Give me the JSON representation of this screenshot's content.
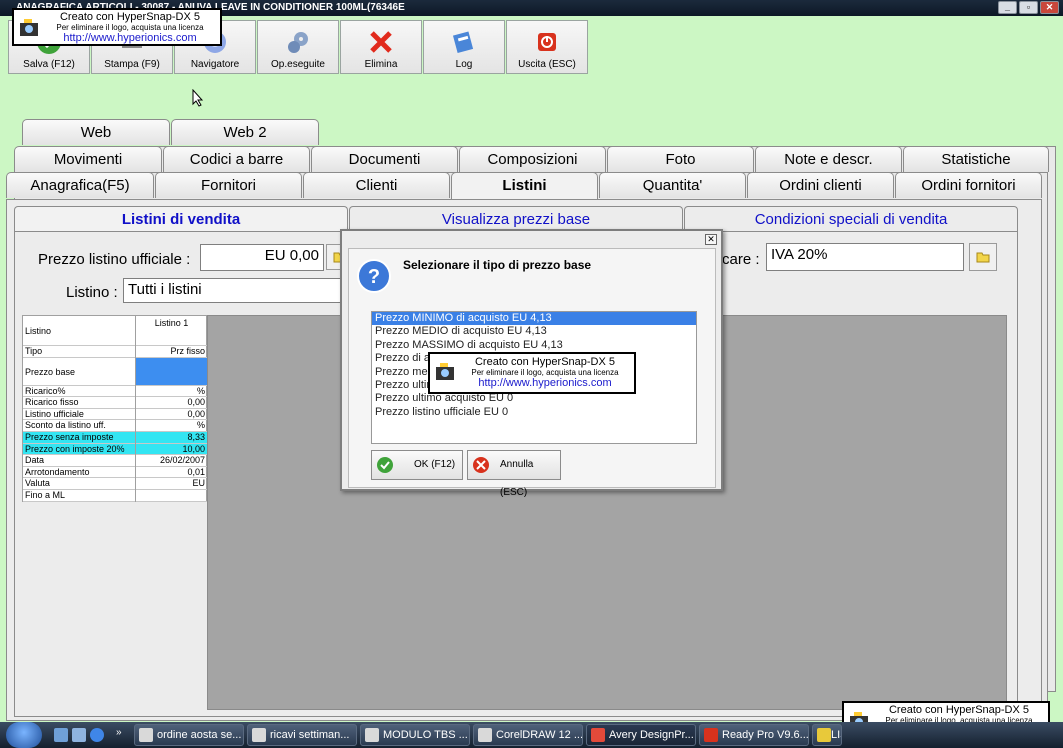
{
  "window": {
    "title": "ANAGRAFICA ARTICOLI - 30087 - ANUVA LEAVE IN CONDITIONER 100ML(76346E"
  },
  "watermark": {
    "line1": "Creato con HyperSnap-DX 5",
    "line2": "Per eliminare il logo, acquista una licenza",
    "line3": "http://www.hyperionics.com"
  },
  "toolbar": [
    {
      "label": "Salva (F12)",
      "icon": "save-icon"
    },
    {
      "label": "Stampa (F9)",
      "icon": "print-icon"
    },
    {
      "label": "Navigatore",
      "icon": "navigator-icon"
    },
    {
      "label": "Op.eseguite",
      "icon": "gears-icon"
    },
    {
      "label": "Elimina",
      "icon": "delete-icon"
    },
    {
      "label": "Log",
      "icon": "log-icon"
    },
    {
      "label": "Uscita (ESC)",
      "icon": "exit-icon"
    }
  ],
  "tabs": {
    "row1": [
      "Web",
      "Web 2"
    ],
    "row2": [
      "Movimenti",
      "Codici a barre",
      "Documenti",
      "Composizioni",
      "Foto",
      "Note e descr.",
      "Statistiche"
    ],
    "row3": [
      "Anagrafica(F5)",
      "Fornitori",
      "Clienti",
      "Listini",
      "Quantita'",
      "Ordini clienti",
      "Ordini fornitori"
    ],
    "active": "Listini"
  },
  "subtabs": [
    "Listini di vendita",
    "Visualizza prezzi base",
    "Condizioni speciali di vendita"
  ],
  "form": {
    "prezzo_label": "Prezzo listino ufficiale :",
    "prezzo_value": "EU 0,00",
    "listino_label": "Listino :",
    "listino_value": "Tutti i listini",
    "iva_label": "care :",
    "iva_value": "IVA 20%"
  },
  "grid": {
    "header_left": "Listino",
    "header_right": "Listino 1",
    "rows": [
      {
        "label": "Tipo",
        "value": "Prz fisso"
      },
      {
        "label": "Prezzo base",
        "value": ""
      },
      {
        "label": "Ricarico%",
        "value": "%"
      },
      {
        "label": "Ricarico fisso",
        "value": "0,00"
      },
      {
        "label": "Listino ufficiale",
        "value": "0,00"
      },
      {
        "label": "Sconto da listino uff.",
        "value": "%"
      },
      {
        "label": "Prezzo senza imposte",
        "value": "8,33"
      },
      {
        "label": "Prezzo con imposte 20%",
        "value": "10,00"
      },
      {
        "label": "Data",
        "value": "26/02/2007"
      },
      {
        "label": "Arrotondamento",
        "value": "0,01"
      },
      {
        "label": "Valuta",
        "value": "EU"
      },
      {
        "label": "Fino a ML",
        "value": ""
      }
    ]
  },
  "dialog": {
    "title": "Selezionare il tipo di prezzo base",
    "options": [
      "Prezzo MINIMO di acquisto EU 4,13",
      "Prezzo MEDIO di acquisto EU 4,13",
      "Prezzo MASSIMO di acquisto EU 4,13",
      "Prezzo di a",
      "Prezzo med",
      "Prezzo ultim",
      "Prezzo ultimo acquisto EU 0",
      "Prezzo listino ufficiale EU 0"
    ],
    "selected_index": 0,
    "ok_label": "OK (F12)",
    "cancel_label": "Annulla (ESC)"
  },
  "taskbar": {
    "tasks": [
      "ordine aosta se...",
      "ricavi settiman...",
      "MODULO TBS ...",
      "CorelDRAW 12 ...",
      "Avery DesignPr...",
      "Ready Pro V9.6....",
      "LIST"
    ]
  }
}
